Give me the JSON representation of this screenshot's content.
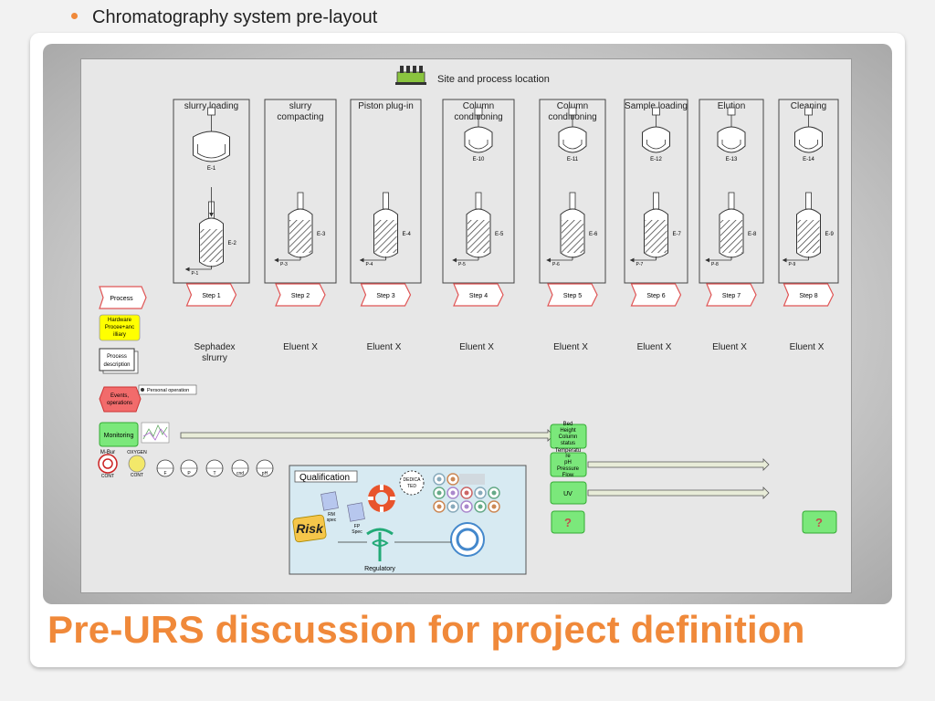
{
  "slide": {
    "bullet": "Chromatography system pre-layout",
    "title": "Pre-URS discussion for project definition"
  },
  "diagram": {
    "header": "Site and process location",
    "columns": [
      {
        "name": "slurry loading",
        "step": "Step 1",
        "eluent": "Sephadex slrurry",
        "vessel_tag": "E-1",
        "column_tag": "E-2",
        "pump_tag": "P-1"
      },
      {
        "name": "slurry compacting",
        "step": "Step 2",
        "eluent": "Eluent X",
        "vessel_tag": "",
        "column_tag": "E-3",
        "pump_tag": "P-3"
      },
      {
        "name": "Piston plug-in",
        "step": "Step 3",
        "eluent": "Eluent X",
        "vessel_tag": "",
        "column_tag": "E-4",
        "pump_tag": "P-4"
      },
      {
        "name": "Column conditioning",
        "step": "Step 4",
        "eluent": "Eluent X",
        "vessel_tag": "E-10",
        "column_tag": "E-5",
        "pump_tag": "P-5"
      },
      {
        "name": "Column conditioning",
        "step": "Step 5",
        "eluent": "Eluent X",
        "vessel_tag": "E-11",
        "column_tag": "E-6",
        "pump_tag": "P-6"
      },
      {
        "name": "Sample loading",
        "step": "Step 6",
        "eluent": "Eluent X",
        "vessel_tag": "E-12",
        "column_tag": "E-7",
        "pump_tag": "P-7"
      },
      {
        "name": "Elution",
        "step": "Step 7",
        "eluent": "Eluent X",
        "vessel_tag": "E-13",
        "column_tag": "E-8",
        "pump_tag": "P-8"
      },
      {
        "name": "Cleaning",
        "step": "Step 8",
        "eluent": "Eluent X",
        "vessel_tag": "E-14",
        "column_tag": "E-9",
        "pump_tag": "P-9"
      }
    ],
    "legend": {
      "process": "Process",
      "hardware": "Hardware Procee+ancillary",
      "description": "Process description",
      "events": "Events, operations",
      "personal": "Personal operation",
      "monitoring": "Monitoring"
    },
    "hazards": [
      "M-Bur CONT",
      "OXYGEN CONT"
    ],
    "sensors": [
      "F",
      "P",
      "T",
      "cnd",
      "pH"
    ],
    "monitors": [
      {
        "label": "Bed Height Column status"
      },
      {
        "label": "Temperature pH Pressure Flow"
      },
      {
        "label": "UV"
      }
    ],
    "unknown": "?",
    "qualification": {
      "title": "Qualification",
      "dedicated": "DEDICATED",
      "rm_spec": "RM spec",
      "fp_spec": "FP Spec",
      "risk": "RISK",
      "regulatory": "Regulatory"
    },
    "colors": {
      "accent": "#f0893a",
      "hardware": "#ffff00",
      "events": "#f26b6b",
      "monitor": "#7be87b",
      "step_border": "#e05555"
    }
  }
}
